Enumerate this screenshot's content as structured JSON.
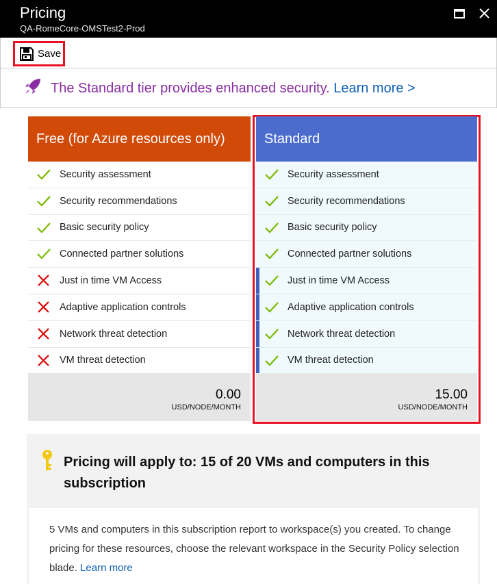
{
  "window": {
    "title": "Pricing",
    "subtitle": "QA-RomeCore-OMSTest2-Prod",
    "maximize_icon": "maximize-icon",
    "close_icon": "close-icon"
  },
  "toolbar": {
    "save_label": "Save",
    "save_icon": "floppy-disk-icon"
  },
  "banner": {
    "icon": "rocket-icon",
    "message": "The Standard tier provides enhanced security.",
    "learn_more": "Learn more >"
  },
  "tiers": {
    "free": {
      "name": "Free (for Azure resources only)",
      "features": [
        {
          "label": "Security assessment",
          "included": true
        },
        {
          "label": "Security recommendations",
          "included": true
        },
        {
          "label": "Basic security policy",
          "included": true
        },
        {
          "label": "Connected partner solutions",
          "included": true
        },
        {
          "label": "Just in time VM Access",
          "included": false
        },
        {
          "label": "Adaptive application controls",
          "included": false
        },
        {
          "label": "Network threat detection",
          "included": false
        },
        {
          "label": "VM threat detection",
          "included": false
        }
      ],
      "price": "0.00",
      "unit": "USD/NODE/MONTH"
    },
    "standard": {
      "name": "Standard",
      "features": [
        {
          "label": "Security assessment",
          "included": true
        },
        {
          "label": "Security recommendations",
          "included": true
        },
        {
          "label": "Basic security policy",
          "included": true
        },
        {
          "label": "Connected partner solutions",
          "included": true
        },
        {
          "label": "Just in time VM Access",
          "included": true
        },
        {
          "label": "Adaptive application controls",
          "included": true
        },
        {
          "label": "Network threat detection",
          "included": true
        },
        {
          "label": "VM threat detection",
          "included": true
        }
      ],
      "price": "15.00",
      "unit": "USD/NODE/MONTH"
    }
  },
  "apply": {
    "icon": "key-icon",
    "heading": "Pricing will apply to: 15 of 20 VMs and computers in this subscription",
    "body": "5 VMs and computers in this subscription report to workspace(s) you created. To change pricing for these resources, choose the relevant workspace in the Security Policy selection blade.",
    "learn_more": "Learn more"
  },
  "colors": {
    "free_header": "#d14a08",
    "standard_header": "#4b6ccc",
    "highlight_border": "#e81123",
    "check": "#7ab800",
    "cross": "#e00000",
    "link": "#0f5fb5",
    "banner_text": "#8a2da3"
  }
}
